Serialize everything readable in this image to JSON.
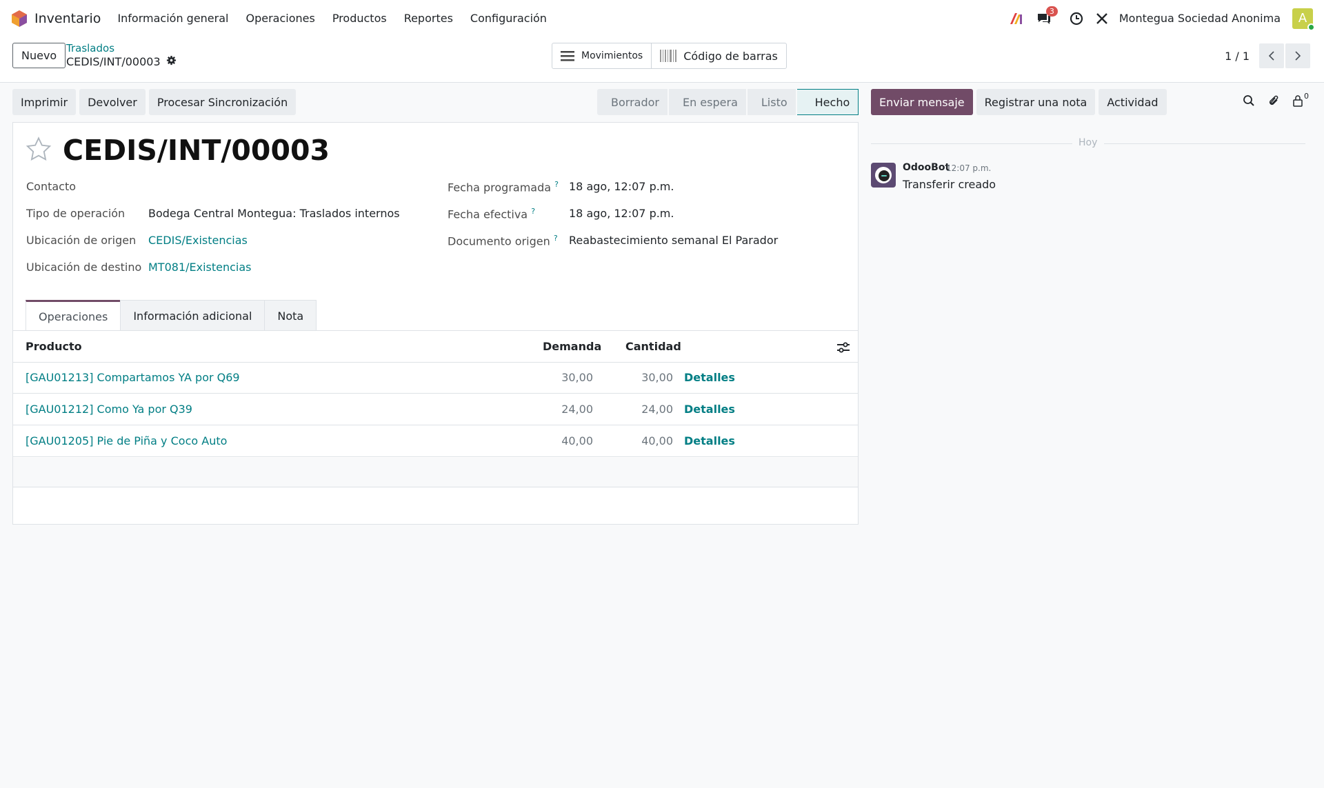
{
  "navbar": {
    "app_name": "Inventario",
    "menu": [
      "Información general",
      "Operaciones",
      "Productos",
      "Reportes",
      "Configuración"
    ],
    "messages_badge": "3",
    "company": "Montegua Sociedad Anonima",
    "avatar_letter": "A"
  },
  "control_panel": {
    "new_label": "Nuevo",
    "breadcrumb_parent": "Traslados",
    "breadcrumb_current": "CEDIS/INT/00003",
    "smart_moves": "Movimientos",
    "smart_barcode": "Código de barras",
    "pager": "1 / 1"
  },
  "actions": {
    "print": "Imprimir",
    "return": "Devolver",
    "sync": "Procesar Sincronización"
  },
  "status": {
    "stages": [
      "Borrador",
      "En espera",
      "Listo",
      "Hecho"
    ],
    "active": "Hecho"
  },
  "form": {
    "title": "CEDIS/INT/00003",
    "contact_label": "Contacto",
    "op_type_label": "Tipo de operación",
    "op_type_value": "Bodega Central Montegua: Traslados internos",
    "src_label": "Ubicación de origen",
    "src_value": "CEDIS/Existencias",
    "dst_label": "Ubicación de destino",
    "dst_value": "MT081/Existencias",
    "scheduled_label": "Fecha programada",
    "scheduled_value": "18 ago, 12:07 p.m.",
    "effective_label": "Fecha efectiva",
    "effective_value": "18 ago, 12:07 p.m.",
    "origin_label": "Documento origen",
    "origin_value": "Reabastecimiento semanal El Parador",
    "help_mark": "?"
  },
  "tabs": [
    "Operaciones",
    "Información adicional",
    "Nota"
  ],
  "table": {
    "headers": {
      "product": "Producto",
      "demand": "Demanda",
      "quantity": "Cantidad"
    },
    "details_label": "Detalles",
    "rows": [
      {
        "product": "[GAU01213] Compartamos YA por Q69",
        "demand": "30,00",
        "quantity": "30,00"
      },
      {
        "product": "[GAU01212] Como Ya por Q39",
        "demand": "24,00",
        "quantity": "24,00"
      },
      {
        "product": "[GAU01205] Pie de Piña y Coco Auto",
        "demand": "40,00",
        "quantity": "40,00"
      }
    ]
  },
  "chatter": {
    "send_message": "Enviar mensaje",
    "log_note": "Registrar una nota",
    "activity": "Actividad",
    "followers_count": "0",
    "today": "Hoy",
    "message": {
      "author": "OdooBot",
      "time": "12:07 p.m.",
      "body": "Transferir creado"
    }
  },
  "colors": {
    "primary": "#714b67",
    "link": "#017e84",
    "badge": "#d9534f"
  }
}
